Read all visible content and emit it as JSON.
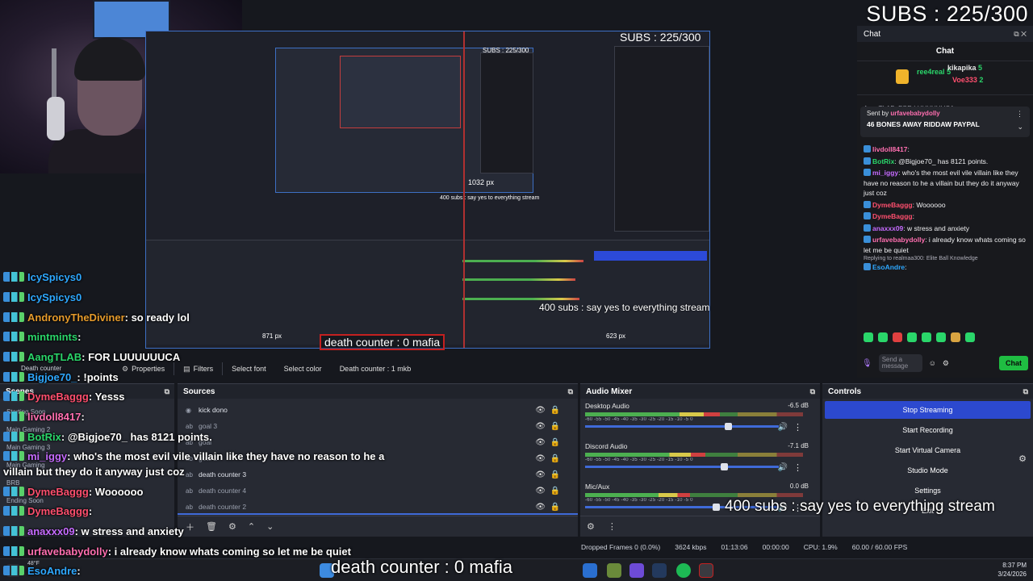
{
  "subs_top": "SUBS : 225/300",
  "preview": {
    "subs": "SUBS : 225/300",
    "subs_mini": "SUBS : 225/300",
    "px_label_1": "1032 px",
    "px_label_2": "871 px",
    "px_label_3": "623 px",
    "ticker": "400 subs : say yes to everything stream",
    "ticker_mini": "400 subs : say yes to everything stream",
    "bottom_ticker": "death counter : 0 mafia"
  },
  "overlay_chat": [
    {
      "user": "IcySpicys0",
      "text": "",
      "color": "#2ea8ff"
    },
    {
      "user": "IcySpicys0",
      "text": "",
      "color": "#2ea8ff"
    },
    {
      "user": "AndronyTheDiviner",
      "text": ": so ready lol",
      "color": "#e59a2b"
    },
    {
      "user": "mintmints",
      "text": ":",
      "color": "#2ad66a"
    },
    {
      "user": "AangTLAB",
      "text": ": FOR LUUUUUUCA",
      "color": "#2ad66a"
    },
    {
      "user": "Bigjoe70_",
      "text": ": !points",
      "color": "#2ea8ff"
    },
    {
      "user": "DymeBaggg",
      "text": ": Yesss",
      "color": "#ff4f6e"
    },
    {
      "user": "livdoll8417",
      "text": ":",
      "color": "#ff6fb0"
    },
    {
      "user": "BotRix",
      "text": ": @Bigjoe70_ has 8121 points.",
      "color": "#2ad66a"
    },
    {
      "user": "mi_iggy",
      "text": ": who's the most evil vile villain like they have no reason to he a",
      "color": "#c66bff"
    },
    {
      "user": "",
      "text": "villain but they do it anyway just coz",
      "color": "#ffffff"
    },
    {
      "user": "DymeBaggg",
      "text": ": Woooooo",
      "color": "#ff4f6e"
    },
    {
      "user": "DymeBaggg",
      "text": ":",
      "color": "#ff4f6e"
    },
    {
      "user": "anaxxx09",
      "text": ": w stress and anxiety",
      "color": "#c66bff"
    },
    {
      "user": "urfavebabydolly",
      "text": ": i already know whats coming so let me be quiet",
      "color": "#ff6fb0"
    },
    {
      "user": "EsoAndre",
      "text": ":",
      "color": "#2ea8ff"
    }
  ],
  "toolbar": {
    "properties": "Properties",
    "filters": "Filters",
    "select_font": "Select font",
    "select_color": "Select color",
    "current_source": "Death counter : 1 mkb",
    "death_counter_label": "Death counter"
  },
  "scenes": {
    "title": "Scenes",
    "items": [
      "Starting Soon",
      "Main Gaming 2",
      "Main Gaming 3",
      "Main Gaming",
      "BRB",
      "Ending Soon"
    ]
  },
  "sources": {
    "title": "Sources",
    "items": [
      {
        "name": "kick dono",
        "faded": false,
        "type": "kick"
      },
      {
        "name": "goal 3",
        "faded": true,
        "type": "ab"
      },
      {
        "name": "goal",
        "faded": true,
        "type": "ab"
      },
      {
        "name": "goal 2",
        "faded": true,
        "type": "ab"
      },
      {
        "name": "death counter 3",
        "faded": false,
        "type": "ab"
      },
      {
        "name": "death counter 4",
        "faded": true,
        "type": "ab"
      },
      {
        "name": "death counter 2",
        "faded": true,
        "type": "ab"
      }
    ]
  },
  "mixer": {
    "title": "Audio Mixer",
    "ticks": "-60 -55 -50 -45 -40 -35 -30 -25 -20 -15 -10 -5 0",
    "channels": [
      {
        "name": "Desktop Audio",
        "db": "-6.5 dB",
        "level": 0.62,
        "fader": 0.72
      },
      {
        "name": "Discord Audio",
        "db": "-7.1 dB",
        "level": 0.55,
        "fader": 0.7
      },
      {
        "name": "Mic/Aux",
        "db": "0.0 dB",
        "level": 0.48,
        "fader": 0.66
      }
    ]
  },
  "controls": {
    "title": "Controls",
    "stop_streaming": "Stop Streaming",
    "start_recording": "Start Recording",
    "start_virtual_camera": "Start Virtual Camera",
    "studio_mode": "Studio Mode",
    "settings": "Settings",
    "exit": "Exit"
  },
  "status": {
    "dropped": "Dropped Frames 0 (0.0%)",
    "kbps": "3624 kbps",
    "stream_time": "01:13:06",
    "rec_time": "00:00:00",
    "cpu": "CPU: 1.9%",
    "fps": "60.00 / 60.00 FPS"
  },
  "dock_ticker": "400 subs : say yes to everything stream",
  "bottom_ticker": "death counter : 0 mafia",
  "taskbar": {
    "weather": "48°F",
    "time": "8:37 PM",
    "date": "3/24/2026"
  },
  "chat": {
    "header": "Chat",
    "title": "Chat",
    "gifters": [
      {
        "name": "ree4real",
        "count": "5",
        "color": "#2ad66a"
      },
      {
        "name": "kikapika",
        "count": "5",
        "color": "#ffffff"
      },
      {
        "name": "Voe333",
        "count": "2",
        "color": "#ff4f6e"
      }
    ],
    "pinned_sent_by": "Sent by",
    "pinned_user": "urfavebabydolly",
    "pinned_text": "46 BONES AWAY RIDDAW PAYPAL",
    "clipped_line": "AangTLAB: FOR LUUUUUUCA",
    "messages": [
      {
        "user": "livdoll8417",
        "text": ":",
        "color": "#ff6fb0"
      },
      {
        "user": "BotRix",
        "text": ": @Bigjoe70_ has 8121 points.",
        "color": "#2ad66a"
      },
      {
        "user": "mi_iggy",
        "text": ": who's the most evil vile villain like they have no reason to he a villain but they do it anyway just coz",
        "color": "#c66bff"
      },
      {
        "user": "DymeBaggg",
        "text": ": Woooooo",
        "color": "#ff4f6e"
      },
      {
        "user": "DymeBaggg",
        "text": ":",
        "color": "#ff4f6e"
      },
      {
        "user": "anaxxx09",
        "text": ": w stress and anxiety",
        "color": "#c66bff"
      },
      {
        "user": "urfavebabydolly",
        "text": ": i already know whats coming so let me be quiet",
        "color": "#ff6fb0"
      }
    ],
    "reply_to": "Replying to realmaa300: Elite Ball Knowledge",
    "last_msg": {
      "user": "EsoAndre",
      "text": ":",
      "color": "#2ea8ff"
    },
    "input_placeholder": "Send a message",
    "send_label": "Chat"
  }
}
